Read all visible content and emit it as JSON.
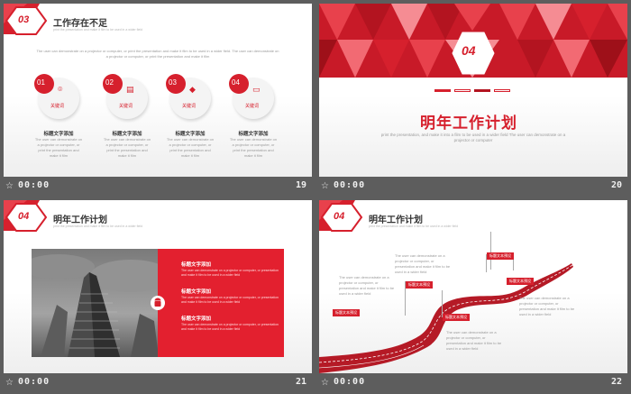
{
  "slides": [
    {
      "number": "19",
      "time": "00:00",
      "badge": "03",
      "title": "工作存在不足",
      "subtitle": "print the presentation and make it film to be used in a wider field",
      "intro": "The user can demonstrate on a projector or computer, or print the presentation and make it film to be used in a wider field. The user can demonstrate on a projector or computer, or print the presentation and make it film",
      "keywords": [
        {
          "num": "01",
          "label": "关键词",
          "icon": "camera-icon",
          "title": "标题文字添加",
          "desc": "The user can demonstrate on a projector or computer, or print the presentation and make it film"
        },
        {
          "num": "02",
          "label": "关键词",
          "icon": "newspaper-icon",
          "title": "标题文字添加",
          "desc": "The user can demonstrate on a projector or computer, or print the presentation and make it film"
        },
        {
          "num": "03",
          "label": "关键词",
          "icon": "graduation-cap-icon",
          "title": "标题文字添加",
          "desc": "The user can demonstrate on a projector or computer, or print the presentation and make it film"
        },
        {
          "num": "04",
          "label": "关键词",
          "icon": "monitor-icon",
          "title": "标题文字添加",
          "desc": "The user can demonstrate on a projector or computer, or print the presentation and make it film"
        }
      ]
    },
    {
      "number": "20",
      "time": "00:00",
      "badge": "04",
      "title": "明年工作计划",
      "desc": "print the presentation, and make it into a film to be used in a wider field The user can demonstrate on a projector or computer"
    },
    {
      "number": "21",
      "time": "00:00",
      "badge": "04",
      "title": "明年工作计划",
      "subtitle": "print the presentation and make it film to be used in a wider field",
      "items": [
        {
          "title": "标题文字添加",
          "desc": "The user can demonstrate on a projector or computer, or presentation and make it film to be used in a wider field"
        },
        {
          "title": "标题文字添加",
          "desc": "The user can demonstrate on a projector or computer, or presentation and make it film to be used in a wider field"
        },
        {
          "title": "标题文字添加",
          "desc": "The user can demonstrate on a projector or computer, or presentation and make it film to be used in a wider field"
        }
      ]
    },
    {
      "number": "22",
      "time": "00:00",
      "badge": "04",
      "title": "明年工作计划",
      "subtitle": "print the presentation and make it film to be used in a wider field",
      "flags": [
        "标题文本预设",
        "标题文本预设",
        "标题文本预设",
        "标题文本预设",
        "标题文本预设"
      ],
      "texts": [
        "The user can demonstrate on a projector or computer, or presentation and make it film to be used in a wider field",
        "The user can demonstrate on a projector or computer, or presentation and make it film to be used in a wider field",
        "The user can demonstrate on a projector or computer, or presentation and make it film to be used in a wider field",
        "The user can demonstrate on a projector or computer, or presentation and make it film to be used in a wider field"
      ]
    }
  ],
  "colors": {
    "accent": "#d6202d",
    "background": "#5d5d5d",
    "text": "#333333"
  }
}
